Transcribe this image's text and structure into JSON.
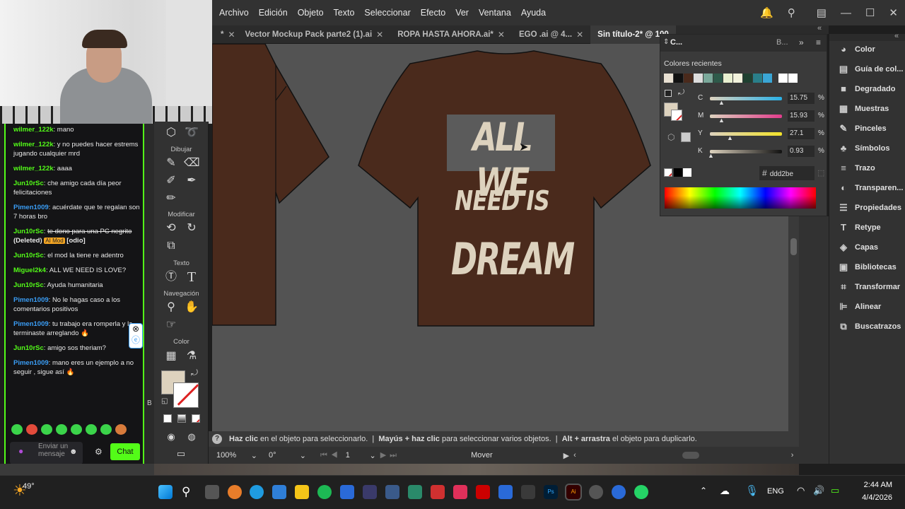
{
  "menu": [
    "Archivo",
    "Edición",
    "Objeto",
    "Texto",
    "Seleccionar",
    "Efecto",
    "Ver",
    "Ventana",
    "Ayuda"
  ],
  "tabs": [
    {
      "label": "*"
    },
    {
      "label": "Vector Mockup Pack parte2  (1).ai"
    },
    {
      "label": "ROPA HASTA AHORA.ai*"
    },
    {
      "label": "EGO .ai @ 4..."
    },
    {
      "label": "Sin título-2* @ 100"
    }
  ],
  "artwork": {
    "line1": "ALL WE",
    "line2": "NEED IS",
    "line3": "DREAM",
    "shirt_color": "#4a2a1c",
    "text_color": "#ddd2be"
  },
  "toolbar": {
    "sections": [
      "Dibujar",
      "Modificar",
      "Texto",
      "Navegación",
      "Color"
    ],
    "fill_color": "#ddd2be"
  },
  "chat": {
    "messages": [
      {
        "user": "wilmer_122k",
        "text": "mano",
        "color": "g"
      },
      {
        "user": "wilmer_122k",
        "text": "y no puedes hacer estrems jugando cualquier mrd",
        "color": "g"
      },
      {
        "user": "wilmer_122k",
        "text": "aaaa",
        "color": "g"
      },
      {
        "user": "Jun10rSc",
        "text": "che amigo cada día peor felicitaciones",
        "color": "g"
      },
      {
        "user": "Pimen1009",
        "text": "acuérdate que te regalan son 7 horas bro",
        "color": "b"
      },
      {
        "user": "Jun10rSc",
        "text": "te dono para una PC negrito",
        "color": "g",
        "strike": true,
        "deleted": "(Deleted)",
        "mod": "AI Mod",
        "reason": "[odio]"
      },
      {
        "user": "Jun10rSc",
        "text": "el mod la tiene re adentro",
        "color": "g"
      },
      {
        "user": "Miguel2k4",
        "text": "ALL WE NEED IS LOVE?",
        "color": "g"
      },
      {
        "user": "Jun10rSc",
        "text": "Ayuda humanitaria",
        "color": "g"
      },
      {
        "user": "Pimen1009",
        "text": "No le hagas caso a los comentarios positivos",
        "color": "b"
      },
      {
        "user": "Pimen1009",
        "text": "tu trabajo era romperla y la terminaste arreglando 🔥",
        "color": "b"
      },
      {
        "user": "Jun10rSc",
        "text": "amigo sos theriam?",
        "color": "g"
      },
      {
        "user": "Pimen1009",
        "text": "mano eres un ejemplo a no seguir , sigue así 🔥",
        "color": "b"
      }
    ],
    "input_placeholder": "Enviar un mensaje",
    "send_label": "Chat"
  },
  "color_panel": {
    "title": "C...",
    "tab2": "B...",
    "recent_label": "Colores recientes",
    "swatches": [
      "#e8e0d2",
      "#111111",
      "#4a2a1c",
      "#dddddd",
      "#7aa89a",
      "#2e5a4a",
      "#e9f0d0",
      "#f2f2dc",
      "#1f4030",
      "#2a7f8a",
      "#3aa6d6",
      "#ffffff",
      "#ffffff"
    ],
    "sliders": [
      {
        "label": "C",
        "value": "15.75",
        "pct": "%",
        "grad": "linear-gradient(90deg,#ddd2be,#29b0e6)",
        "pos": 0.1575
      },
      {
        "label": "M",
        "value": "15.93",
        "pct": "%",
        "grad": "linear-gradient(90deg,#ddd2be,#e23c8c)",
        "pos": 0.1593
      },
      {
        "label": "Y",
        "value": "27.1",
        "pct": "%",
        "grad": "linear-gradient(90deg,#ddd2be,#f2e22a)",
        "pos": 0.271
      },
      {
        "label": "K",
        "value": "0.93",
        "pct": "%",
        "grad": "linear-gradient(90deg,#ddd2be,#111111)",
        "pos": 0.0093
      }
    ],
    "hex_symbol": "#",
    "hex": "ddd2be"
  },
  "dock": [
    {
      "label": "Color",
      "icon": "palette-icon",
      "glyph": "◕"
    },
    {
      "label": "Guía de col...",
      "icon": "color-guide-icon",
      "glyph": "▤"
    },
    {
      "label": "Degradado",
      "icon": "gradient-icon",
      "glyph": "■"
    },
    {
      "label": "Muestras",
      "icon": "swatches-icon",
      "glyph": "▦"
    },
    {
      "label": "Pinceles",
      "icon": "brush-icon",
      "glyph": "✎"
    },
    {
      "label": "Símbolos",
      "icon": "symbols-icon",
      "glyph": "♣"
    },
    {
      "label": "Trazo",
      "icon": "stroke-icon",
      "glyph": "≡"
    },
    {
      "label": "Transparen...",
      "icon": "transparency-icon",
      "glyph": "◐"
    },
    {
      "label": "Propiedades",
      "icon": "properties-icon",
      "glyph": "☰"
    },
    {
      "label": "Retype",
      "icon": "retype-icon",
      "glyph": "T"
    },
    {
      "label": "Capas",
      "icon": "layers-icon",
      "glyph": "◈"
    },
    {
      "label": "Bibliotecas",
      "icon": "libraries-icon",
      "glyph": "▣"
    },
    {
      "label": "Transformar",
      "icon": "transform-icon",
      "glyph": "⌗"
    },
    {
      "label": "Alinear",
      "icon": "align-icon",
      "glyph": "⊫"
    },
    {
      "label": "Buscatrazos",
      "icon": "pathfinder-icon",
      "glyph": "⧉"
    }
  ],
  "status": {
    "hint_bold1": "Haz clic",
    "hint1": " en el objeto para seleccionarlo.  |  ",
    "hint_bold2": "Mayús + haz clic",
    "hint2": " para seleccionar varios objetos.  |  ",
    "hint_bold3": "Alt + arrastra",
    "hint3": " el objeto para duplicarlo.",
    "zoom": "100%",
    "rotation": "0°",
    "artboard": "1",
    "tool": "Mover"
  },
  "taskbar": {
    "weather": "49°",
    "lang": "ENG",
    "time": "2:44 AM",
    "date": "4/4/2026"
  }
}
